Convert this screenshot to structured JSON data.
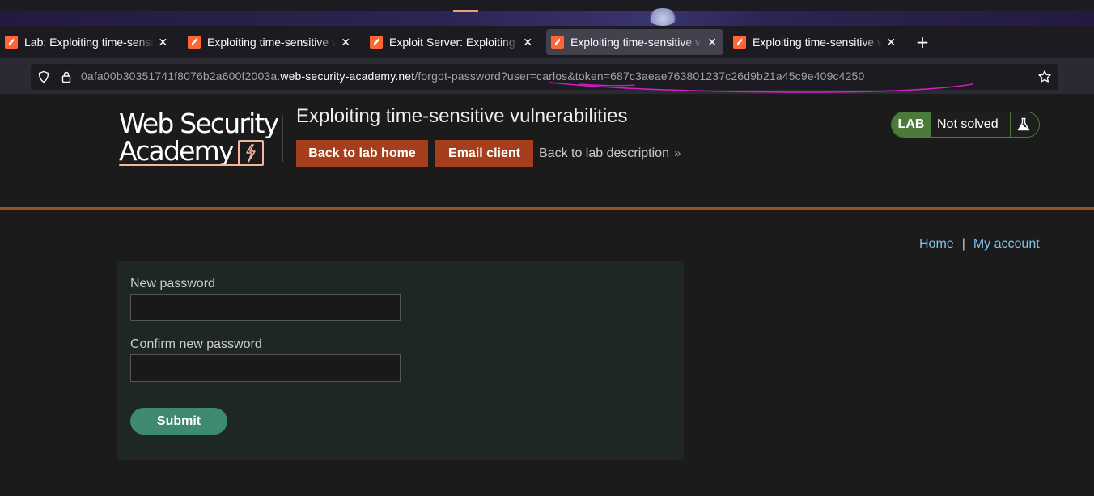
{
  "browser": {
    "tabs": [
      {
        "title": "Lab: Exploiting time-sensitive vulnerabilities",
        "active": false
      },
      {
        "title": "Exploiting time-sensitive vulnerabilities",
        "active": false
      },
      {
        "title": "Exploit Server: Exploiting time-sensitive vulnerabilities",
        "active": false
      },
      {
        "title": "Exploiting time-sensitive vulnerabilities",
        "active": true
      },
      {
        "title": "Exploiting time-sensitive vulnerabilities",
        "active": false
      }
    ],
    "close_glyph": "✕",
    "new_tab_glyph": "+",
    "url": {
      "subdomain": "0afa00b30351741f8076b2a600f2003a.",
      "domain": "web-security-academy.net",
      "path": "/forgot-password?user=carlos&token=687c3aeae763801237c26d9b21a45c9e409c4250"
    }
  },
  "header": {
    "logo_line1": "Web Security",
    "logo_line2": "Academy",
    "lab_title": "Exploiting time-sensitive vulnerabilities",
    "back_to_lab_home": "Back to lab home",
    "email_client": "Email client",
    "back_to_lab_description": "Back to lab description",
    "chevron": "»",
    "status_badge": "LAB",
    "status_text": "Not solved"
  },
  "nav": {
    "home": "Home",
    "separator": "|",
    "my_account": "My account"
  },
  "form": {
    "new_password_label": "New password",
    "new_password_value": "",
    "confirm_password_label": "Confirm new password",
    "confirm_password_value": "",
    "submit_label": "Submit"
  },
  "colors": {
    "accent_orange": "#a43e1c",
    "lab_green": "#4b7a3a",
    "submit_green": "#3e8a6e",
    "link_blue": "#7ec3e6",
    "annotation_magenta": "#d41cc8"
  }
}
